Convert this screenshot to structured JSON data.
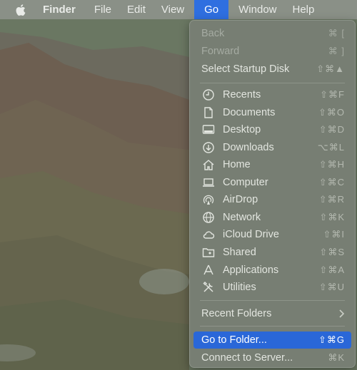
{
  "menubar": {
    "apple_icon": "apple-logo-icon",
    "items": [
      "Finder",
      "File",
      "Edit",
      "View",
      "Go",
      "Window",
      "Help"
    ]
  },
  "menu": {
    "back": {
      "label": "Back",
      "shortcut": "⌘ ["
    },
    "forward": {
      "label": "Forward",
      "shortcut": "⌘ ]"
    },
    "startup_disk": {
      "label": "Select Startup Disk",
      "shortcut": "⇧⌘▲"
    },
    "recents": {
      "label": "Recents",
      "shortcut": "⇧⌘F",
      "icon": "clock-icon"
    },
    "documents": {
      "label": "Documents",
      "shortcut": "⇧⌘O",
      "icon": "document-icon"
    },
    "desktop": {
      "label": "Desktop",
      "shortcut": "⇧⌘D",
      "icon": "desktop-icon"
    },
    "downloads": {
      "label": "Downloads",
      "shortcut": "⌥⌘L",
      "icon": "download-icon"
    },
    "home": {
      "label": "Home",
      "shortcut": "⇧⌘H",
      "icon": "home-icon"
    },
    "computer": {
      "label": "Computer",
      "shortcut": "⇧⌘C",
      "icon": "laptop-icon"
    },
    "airdrop": {
      "label": "AirDrop",
      "shortcut": "⇧⌘R",
      "icon": "airdrop-icon"
    },
    "network": {
      "label": "Network",
      "shortcut": "⇧⌘K",
      "icon": "globe-icon"
    },
    "icloud": {
      "label": "iCloud Drive",
      "shortcut": "⇧⌘I",
      "icon": "cloud-icon"
    },
    "shared": {
      "label": "Shared",
      "shortcut": "⇧⌘S",
      "icon": "shared-folder-icon"
    },
    "applications": {
      "label": "Applications",
      "shortcut": "⇧⌘A",
      "icon": "applications-icon"
    },
    "utilities": {
      "label": "Utilities",
      "shortcut": "⇧⌘U",
      "icon": "tools-icon"
    },
    "recent_folders": {
      "label": "Recent Folders",
      "icon": "chevron-right-icon"
    },
    "go_to_folder": {
      "label": "Go to Folder...",
      "shortcut": "⇧⌘G"
    },
    "connect_server": {
      "label": "Connect to Server...",
      "shortcut": "⌘K"
    }
  },
  "colors": {
    "selection": "#2a67d8",
    "menubar_active": "#2f6fe0",
    "menu_bg": "#777e73"
  }
}
